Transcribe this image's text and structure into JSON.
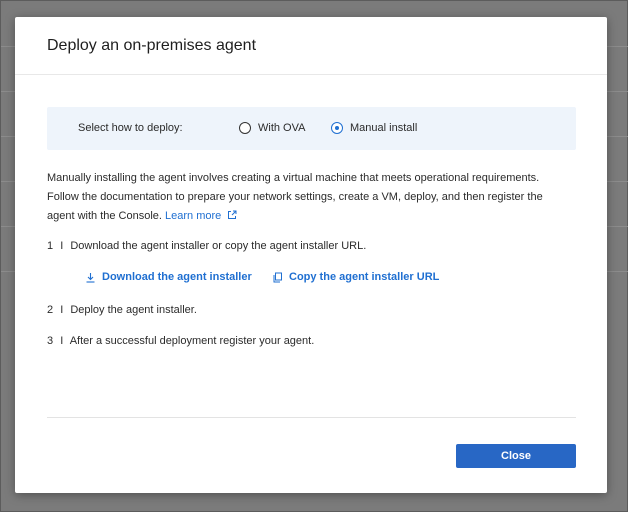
{
  "dialog": {
    "title": "Deploy an on-premises agent"
  },
  "deploy_method": {
    "label": "Select how to deploy:",
    "options": [
      {
        "label": "With OVA",
        "selected": false
      },
      {
        "label": "Manual install",
        "selected": true
      }
    ]
  },
  "description": {
    "text": "Manually installing the agent involves creating a virtual machine that meets operational requirements. Follow the documentation to prepare your network settings, create a VM, deploy, and then register the agent with the Console.",
    "learn_more": "Learn more"
  },
  "steps": [
    {
      "number": "1",
      "separator": "I",
      "text": "Download the agent installer or copy the agent installer URL."
    },
    {
      "number": "2",
      "separator": "I",
      "text": "Deploy the agent installer."
    },
    {
      "number": "3",
      "separator": "I",
      "text": "After a successful deployment register your agent."
    }
  ],
  "actions": {
    "download_label": "Download the agent installer",
    "copy_label": "Copy the agent installer URL"
  },
  "footer": {
    "close_label": "Close"
  },
  "colors": {
    "accent": "#1f6fd1",
    "primary_button": "#2867c5",
    "deploy_box_bg": "#eef4fb"
  },
  "icons": {
    "external_link": "external-link-icon",
    "download": "download-icon",
    "copy": "copy-icon"
  }
}
